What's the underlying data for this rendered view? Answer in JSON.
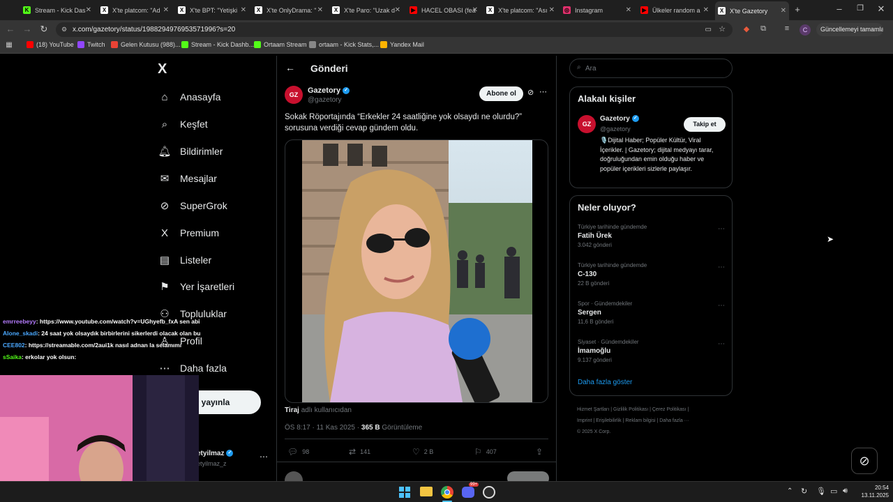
{
  "browser": {
    "tabs": [
      {
        "label": "Stream - Kick Das",
        "color": "#53fc18",
        "letter": "K"
      },
      {
        "label": "X'te platcom: \"Ad",
        "color": "#ffffff",
        "letter": "X"
      },
      {
        "label": "X'te BPT: \"Yetişki",
        "color": "#ffffff",
        "letter": "X"
      },
      {
        "label": "X'te OnlyDrama: \"",
        "color": "#ffffff",
        "letter": "X"
      },
      {
        "label": "X'te Paro: \"Uzak d",
        "color": "#ffffff",
        "letter": "X"
      },
      {
        "label": "HACEL OBASI (fea",
        "color": "#ff0000",
        "letter": "▶"
      },
      {
        "label": "X'te platcom: \"Ası",
        "color": "#ffffff",
        "letter": "X"
      },
      {
        "label": "Instagram",
        "color": "#e1306c",
        "letter": "◎"
      },
      {
        "label": "Ülkeler random a",
        "color": "#ff0000",
        "letter": "▶"
      },
      {
        "label": "X'te Gazetory",
        "color": "#ffffff",
        "letter": "X"
      }
    ],
    "url": "x.com/gazetory/status/1988294976953571996?s=20",
    "update_label": "Güncellemeyi tamamla",
    "profile_letter": "C",
    "bookmarks": [
      {
        "label": "(18) YouTube",
        "color": "#ff0000"
      },
      {
        "label": "Twitch",
        "color": "#9146ff"
      },
      {
        "label": "Gelen Kutusu (988)...",
        "color": "#ea4335"
      },
      {
        "label": "Stream - Kick Dashb...",
        "color": "#53fc18"
      },
      {
        "label": "Ortaam Stream",
        "color": "#53fc18"
      },
      {
        "label": "ortaam - Kick Stats,...",
        "color": "#888888"
      },
      {
        "label": "Yandex Mail",
        "color": "#ffb300"
      }
    ]
  },
  "sidebar": {
    "logo": "X",
    "items": [
      {
        "label": "Anasayfa",
        "icon": "⌂"
      },
      {
        "label": "Keşfet",
        "icon": "⌕"
      },
      {
        "label": "Bildirimler",
        "icon": "🔔︎"
      },
      {
        "label": "Mesajlar",
        "icon": "✉"
      },
      {
        "label": "SuperGrok",
        "icon": "⊘"
      },
      {
        "label": "Premium",
        "icon": "X"
      },
      {
        "label": "Listeler",
        "icon": "▤"
      },
      {
        "label": "Yer İşaretleri",
        "icon": "⚑"
      },
      {
        "label": "Topluluklar",
        "icon": "⚇"
      },
      {
        "label": "Profil",
        "icon": "♙"
      },
      {
        "label": "Daha fazla",
        "icon": "⋯"
      }
    ],
    "post_button": "eri yayınla",
    "account_name": "etyilmaz",
    "account_handle": "etyilmaz_z"
  },
  "post": {
    "header": "Gönderi",
    "author_name": "Gazetory",
    "author_handle": "@gazetory",
    "follow_label": "Abone ol",
    "text": "Sokak Röportajında “Erkekler 24 saatliğine yok olsaydı ne olurdu?” sorusuna verdiği cevap gündem oldu.",
    "credit_name": "Tiraj",
    "credit_suffix": "adlı kullanıcıdan",
    "time": "ÖS 8:17 · 11 Kas 2025 ·",
    "views_count": "365 B",
    "views_label": "Görüntüleme",
    "replies": "98",
    "reposts": "141",
    "likes": "2 B",
    "bookmarks": "407"
  },
  "right": {
    "search_placeholder": "Ara",
    "relevant_title": "Alakalı kişiler",
    "person_name": "Gazetory",
    "person_handle": "@gazetory",
    "person_follow": "Takip et",
    "person_bio": "🎙️Dijital Haber; Popüler Kültür, Viral İçerikler. | Gazetory; dijital medyayı tarar, doğruluğundan emin olduğu haber ve popüler içerikleri sizlerle paylaşır.",
    "trends_title": "Neler oluyor?",
    "trends": [
      {
        "cat": "Türkiye tarihinde gündemde",
        "name": "Fatih Ürek",
        "count": "3.042 gönderi"
      },
      {
        "cat": "Türkiye tarihinde gündemde",
        "name": "C-130",
        "count": "22 B gönderi"
      },
      {
        "cat": "Spor · Gündemdekiler",
        "name": "Sergen",
        "count": "11,6 B gönderi"
      },
      {
        "cat": "Siyaset · Gündemdekiler",
        "name": "İmamoğlu",
        "count": "9.137 gönderi"
      }
    ],
    "show_more": "Daha fazla göster",
    "footer_line1": "Hizmet Şartları  |  Gizlilik Politikası  |  Çerez Politikası  |",
    "footer_line2": "Imprint  |  Erişilebilirlik  |  Reklam bilgisi  |  Daha fazla ···",
    "footer_line3": "© 2025 X Corp."
  },
  "chat": [
    {
      "user": "emrreebeyy",
      "color": "#b57cff",
      "text": ": https://www.youtube.com/watch?v=UGhyefb_fxA sen abi"
    },
    {
      "user": "Alone_skadi",
      "color": "#4aa8ff",
      "text": ": 24 saat yok olsaydık birbirlerini sikerlerdi olacak olan bu"
    },
    {
      "user": "CEE802",
      "color": "#4aa8ff",
      "text": ": https://streamable.com/2aui1k nasıl adnan la selamımı"
    },
    {
      "user": "sSaika",
      "color": "#53fc18",
      "text": ": erkolar yok olsun:"
    }
  ],
  "taskbar": {
    "time": "20:54",
    "date": "13.11.2025",
    "discord_badge": "99+"
  }
}
